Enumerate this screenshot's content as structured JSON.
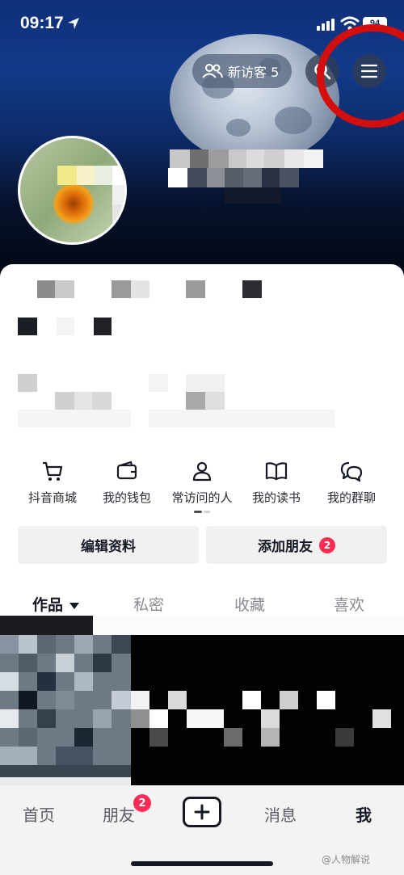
{
  "status_bar": {
    "time": "09:17",
    "battery": "94"
  },
  "header": {
    "visitors_label": "新访客 5"
  },
  "shortcuts": [
    {
      "label": "抖音商城",
      "icon": "cart-icon"
    },
    {
      "label": "我的钱包",
      "icon": "wallet-icon"
    },
    {
      "label": "常访问的人",
      "icon": "person-icon"
    },
    {
      "label": "我的读书",
      "icon": "book-icon"
    },
    {
      "label": "我的群聊",
      "icon": "chat-bubbles-icon"
    }
  ],
  "actions": {
    "edit_profile": "编辑资料",
    "add_friends": "添加朋友",
    "add_friends_badge": "2"
  },
  "tabs": [
    "作品",
    "私密",
    "收藏",
    "喜欢"
  ],
  "bottom_nav": {
    "home": "首页",
    "friends": "朋友",
    "friends_badge": "2",
    "messages": "消息",
    "me": "我"
  },
  "watermark": "@人物解说",
  "colors": {
    "accent_red": "#fe2c55",
    "annotation_red": "#d40d0d",
    "banner_blue": "#123a8a"
  }
}
